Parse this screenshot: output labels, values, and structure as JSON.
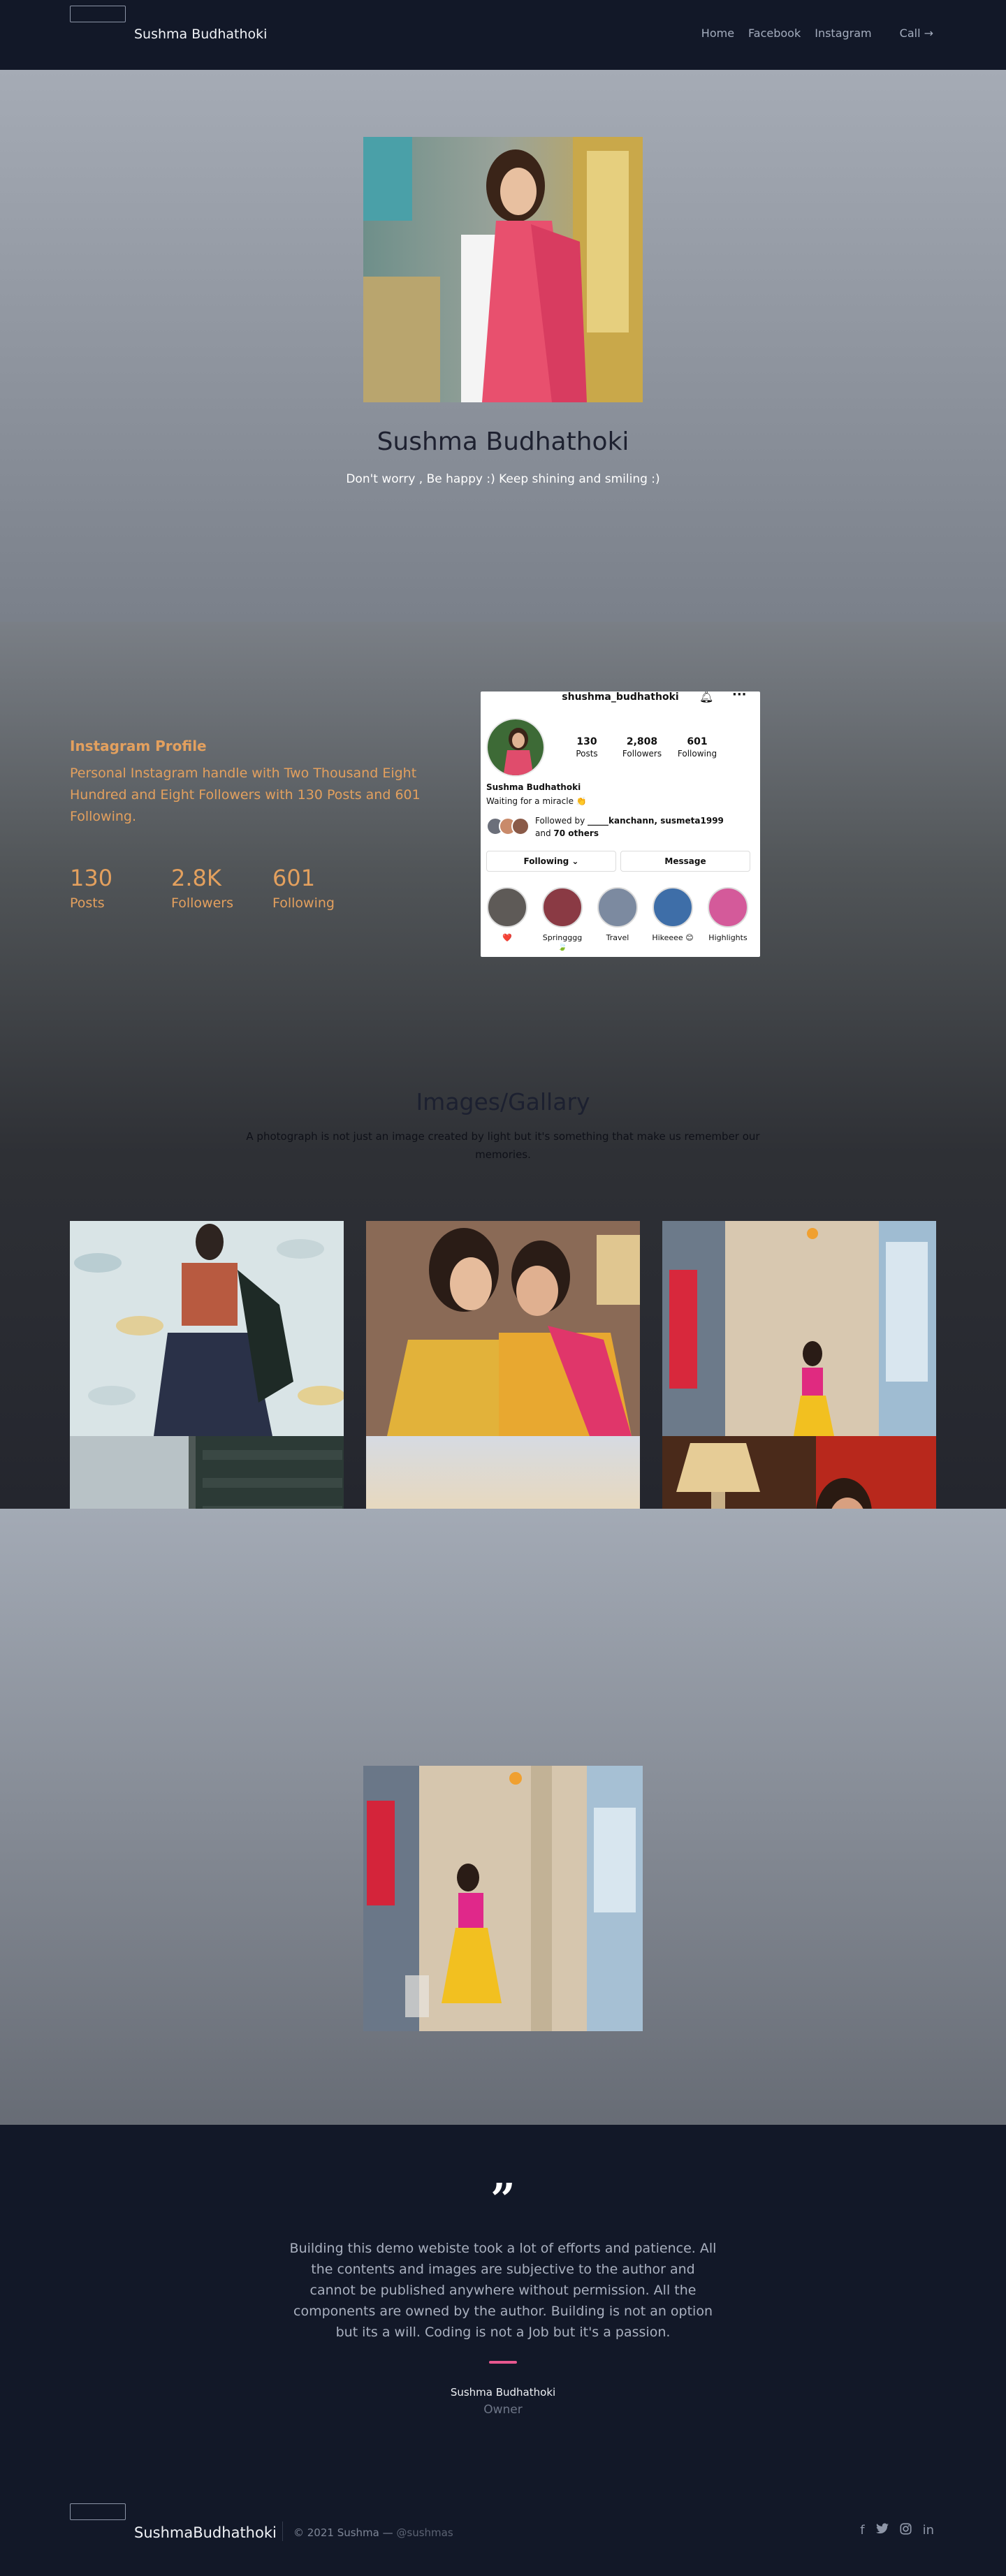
{
  "header": {
    "brand": "Sushma Budhathoki",
    "nav": [
      "Home",
      "Facebook",
      "Instagram"
    ],
    "call": "Call →"
  },
  "hero": {
    "title": "Sushma Budhathoki",
    "subtitle": "Don't worry , Be happy :) Keep shining and smiling :)"
  },
  "instagram": {
    "heading": "Instagram Profile",
    "description": "Personal Instagram handle with Two Thousand Eight Hundred and Eight Followers with 130 Posts and 601 Following.",
    "stats": [
      {
        "value": "130",
        "label": "Posts"
      },
      {
        "value": "2.8K",
        "label": "Followers"
      },
      {
        "value": "601",
        "label": "Following"
      }
    ]
  },
  "profile_card": {
    "username": "shushma_budhathoki",
    "stats": [
      {
        "num": "130",
        "label": "Posts"
      },
      {
        "num": "2,808",
        "label": "Followers"
      },
      {
        "num": "601",
        "label": "Following"
      }
    ],
    "name": "Sushma Budhathoki",
    "bio": "Waiting for a miracle 👏",
    "followed_prefix": "Followed by ",
    "followed_names": "_____kanchann, susmeta1999",
    "followed_and": "and ",
    "followed_others": "70 others",
    "following_btn": "Following ⌄",
    "message_btn": "Message",
    "highlights": [
      "❤️",
      "Springggg 🍃",
      "Travel",
      "Hikeeee 😊",
      "Highlights"
    ]
  },
  "gallery": {
    "title": "Images/Gallary",
    "subtitle": "A photograph is not just an image created by light but it's something that make us remember our memories.",
    "progress": 0.25
  },
  "testimonial": {
    "quote_mark": "”",
    "text": "Building this demo webiste took a lot of efforts and patience. All the contents and images are subjective to the author and cannot be published anywhere without permission. All the components are owned by the author. Building is not an option but its a will. Coding is not a Job but it's a passion.",
    "name": "Sushma Budhathoki",
    "role": "Owner"
  },
  "footer": {
    "brand": "SushmaBudhathoki",
    "copyright": "© 2021 Sushma — ",
    "handle": "@sushmas",
    "social": [
      "facebook-icon",
      "twitter-icon",
      "instagram-icon",
      "linkedin-icon"
    ]
  },
  "colors": {
    "accent": "#e3a05e",
    "nav_bg": "#121828",
    "quote_line": "#e8578f"
  }
}
